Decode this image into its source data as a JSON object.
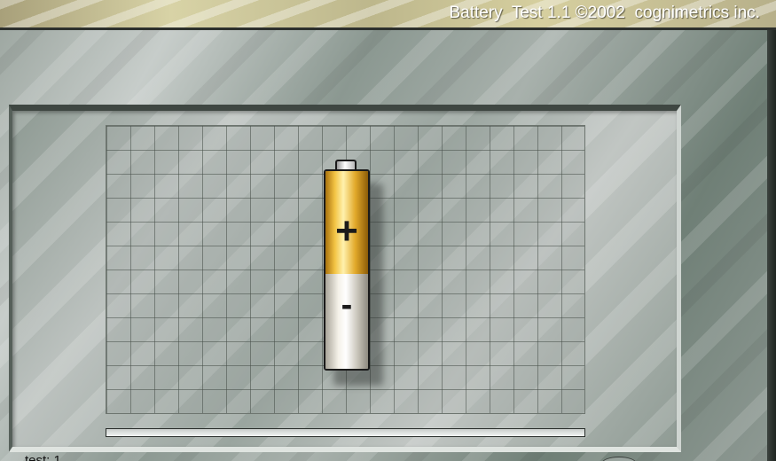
{
  "app": {
    "title": "Battery  Test 1.1 ©2002  cognimetrics inc."
  },
  "battery": {
    "plus_label": "+",
    "minus_label": "-",
    "icon": "aa-battery-icon"
  },
  "progress": {
    "fraction": 0
  },
  "status": {
    "test_label": "test: 1"
  }
}
